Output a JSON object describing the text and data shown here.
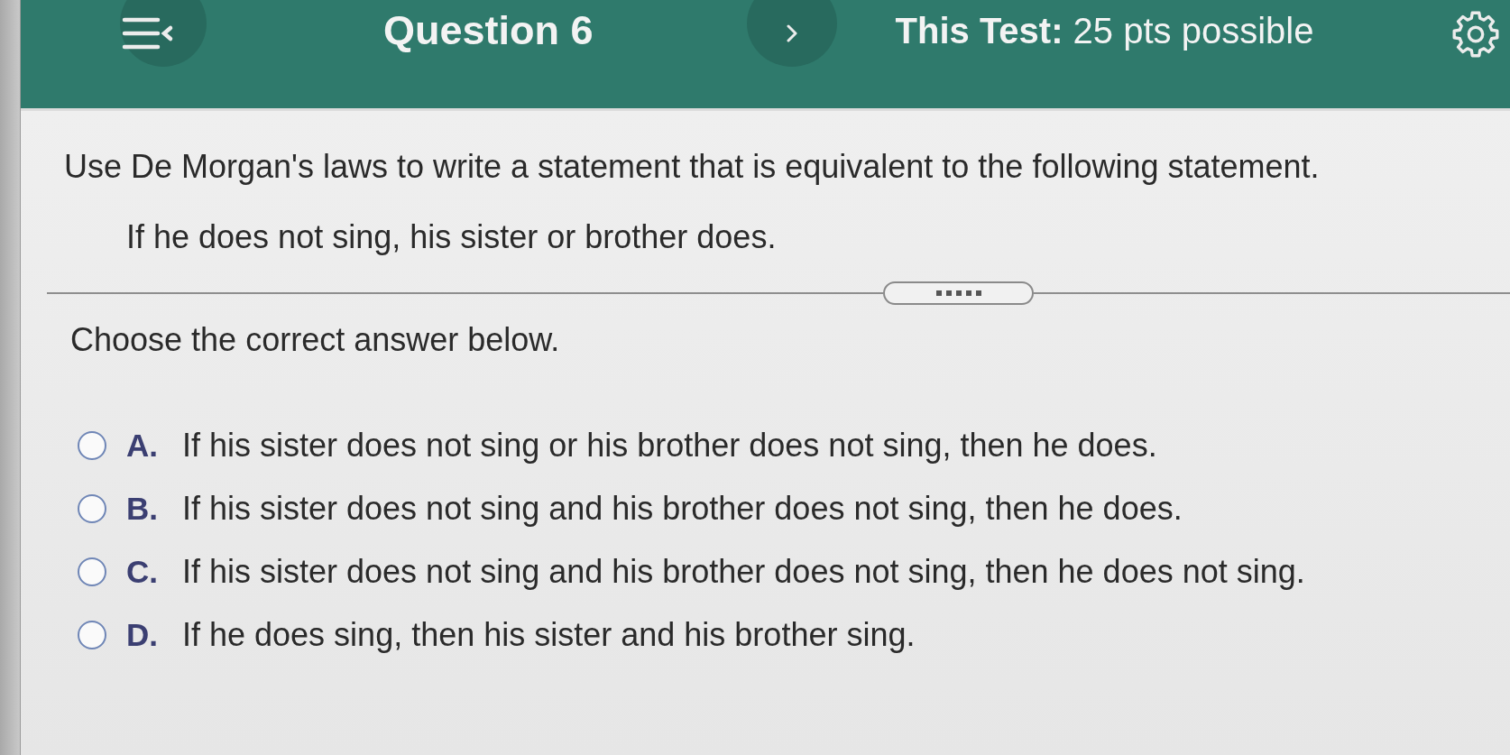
{
  "header": {
    "title": "Question 6",
    "score": "**This Test:** 25 pts possible"
  },
  "question": {
    "prompt": "Use De Morgan's laws to write a statement that is equivalent to the following statement.",
    "statement": "If he does not sing, his sister or brother does."
  },
  "instruction": "Choose the correct answer below.",
  "options": [
    {
      "letter": "A.",
      "text": "If his sister does not sing or his brother does not sing, then he does.",
      "selected": false
    },
    {
      "letter": "B.",
      "text": "If his sister does not sing and his brother does not sing, then he does.",
      "selected": false
    },
    {
      "letter": "C.",
      "text": "If his sister does not sing and his brother does not sing, then he does not sing.",
      "selected": false
    },
    {
      "letter": "D.",
      "text": "If he does sing, then his sister and his brother sing.",
      "selected": false
    }
  ]
}
